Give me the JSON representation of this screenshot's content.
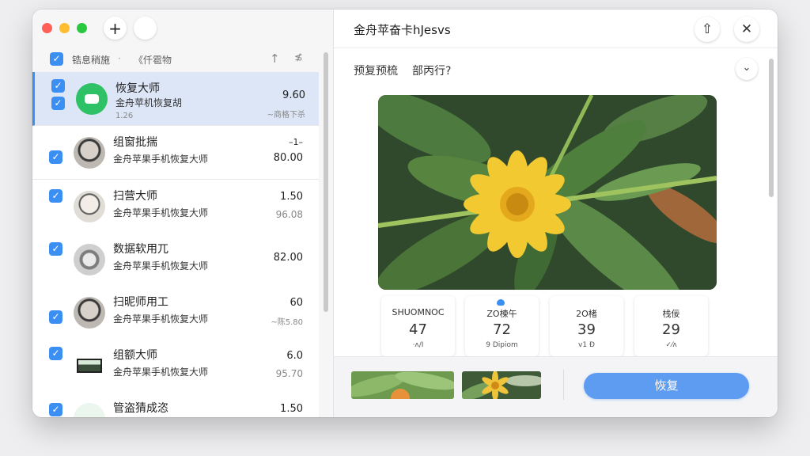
{
  "sidebar": {
    "filter": {
      "select_all_label": "锆息稍施",
      "separator": "·",
      "sort_label": "《仟雹物"
    },
    "rows": [
      {
        "title": "恢复大师",
        "subtitle": "金舟苹机恢复胡",
        "extra": "1.26",
        "value": "9.60",
        "meta": "~商格下杀"
      },
      {
        "title": "组窗批揣",
        "subtitle": "金舟苹果手机恢复大师",
        "value": "80.00",
        "meta": "–1–"
      },
      {
        "title": "扫营大师",
        "subtitle": "金舟苹果手机恢复大师",
        "value": "1.50",
        "meta": "96.08"
      },
      {
        "title": "数据软用兀",
        "subtitle": "金舟苹果手机恢复大师",
        "value": "82.00",
        "meta": ""
      },
      {
        "title": "扫昵师用工",
        "subtitle": "金舟苹果手机恢复大师",
        "value": "60",
        "meta": "~陈5.80"
      },
      {
        "title": "组额大师",
        "subtitle": "金舟苹果手机恢复大师",
        "value": "6.0",
        "meta": "95.70"
      },
      {
        "title": "管盗猜成恣",
        "subtitle": "",
        "value": "1.50",
        "meta": ""
      }
    ]
  },
  "detail": {
    "title": "金舟苹奋卡hJesvs",
    "subheader": {
      "left": "预复预梳",
      "right": "部丙行?"
    },
    "collapse_symbol": "⌄",
    "stats": [
      {
        "label": "SHUOMNOC",
        "value": "47",
        "unit": "·ʌ/I"
      },
      {
        "label": "ZO楝午",
        "value": "72",
        "unit": "9 Dipiom"
      },
      {
        "label": "2O楮",
        "value": "39",
        "unit": "v1 Ð"
      },
      {
        "label": "栈佞",
        "value": "29",
        "unit": "✓⁄ᴧ"
      }
    ],
    "restore_label": "恢复"
  },
  "icons": {
    "add": "+",
    "upload": "⇧",
    "close": "✕",
    "sort_up": "↑",
    "filter_x": "≴",
    "check": "✓"
  },
  "colors": {
    "accent": "#3b8ff3",
    "selected_row": "#dce6f6",
    "restore_button": "#5d9cf0"
  }
}
